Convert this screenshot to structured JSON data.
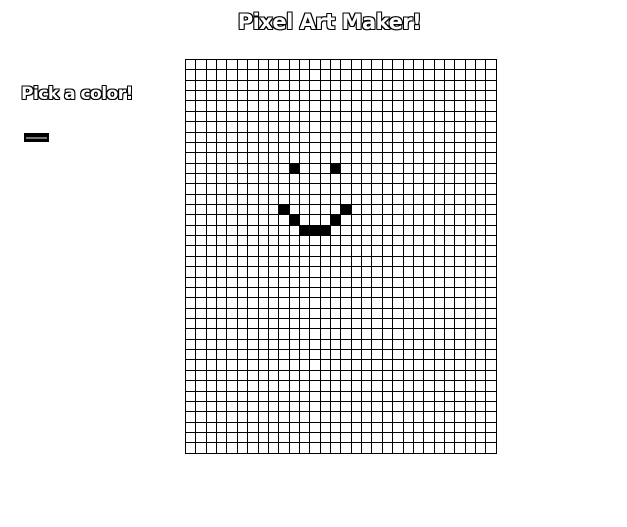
{
  "header": {
    "title": "Pixel Art Maker!"
  },
  "color_picker": {
    "label": "Pick a color!",
    "value": "#000000",
    "icon": "color-swatch"
  },
  "canvas": {
    "rows": 38,
    "cols": 30,
    "paint_color": "#000000",
    "filled_cells": [
      [
        10,
        10
      ],
      [
        10,
        14
      ],
      [
        14,
        9
      ],
      [
        14,
        15
      ],
      [
        15,
        10
      ],
      [
        15,
        14
      ],
      [
        16,
        11
      ],
      [
        16,
        12
      ],
      [
        16,
        13
      ]
    ]
  }
}
